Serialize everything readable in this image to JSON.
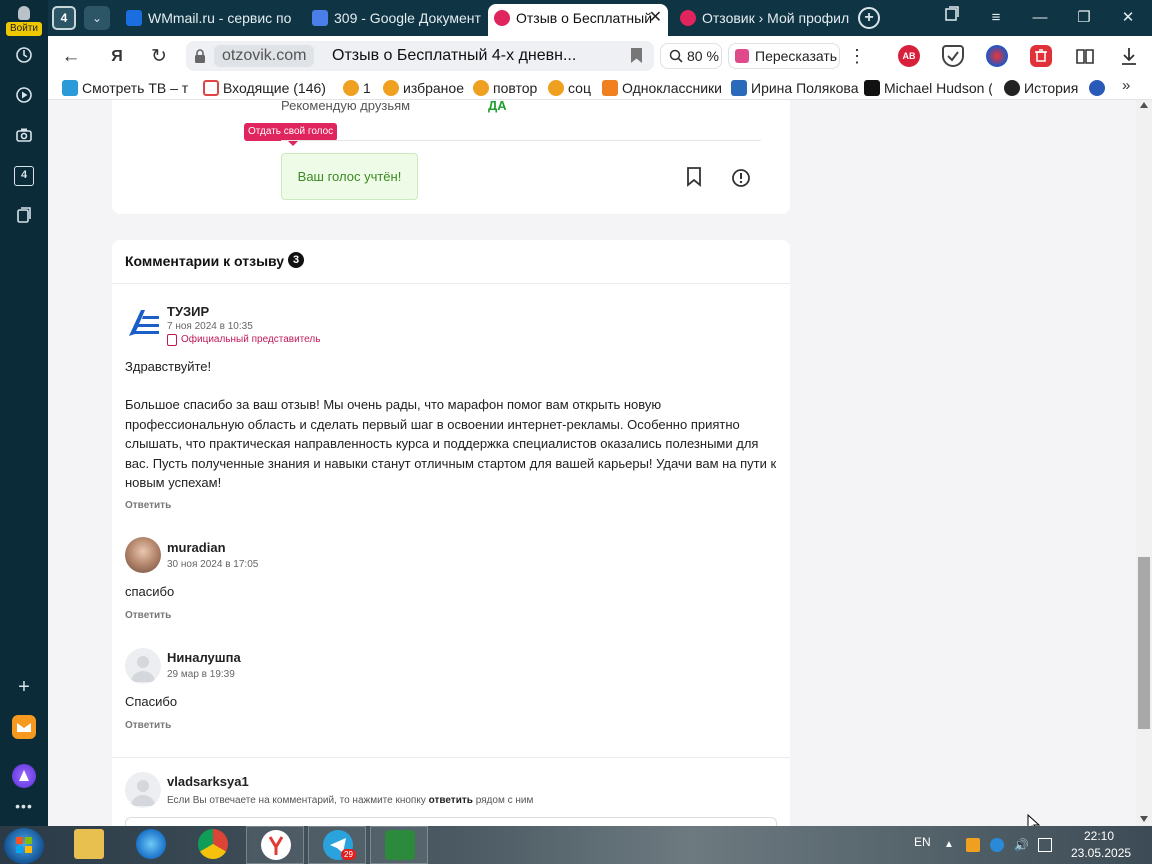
{
  "browser": {
    "sidebar": {
      "login_label": "Войти",
      "items": [
        "history-icon",
        "play-icon",
        "camera-icon",
        "collections-badge",
        "notes-icon"
      ],
      "collections_badge": "4"
    },
    "tab_counter": "4",
    "tabs": [
      {
        "label": "WMmail.ru - сервис по",
        "icon": "wmmail-icon",
        "color": "#1a6ee0",
        "active": false
      },
      {
        "label": "309 - Google Документ",
        "icon": "google-docs-icon",
        "color": "#4a7ee8",
        "active": false
      },
      {
        "label": "Отзыв о Бесплатный",
        "icon": "otzovik-icon",
        "color": "#e0245e",
        "active": true
      },
      {
        "label": "Отзовик › Мой профил",
        "icon": "otzovik-icon",
        "color": "#e0245e",
        "active": false
      }
    ],
    "address": {
      "domain": "otzovik.com",
      "page_title": "Отзыв о Бесплатный 4-х дневн...",
      "zoom": "80 %",
      "retell_label": "Пересказать"
    },
    "bookmarks": [
      {
        "label": "Смотреть ТВ – те",
        "icon": "tv-icon",
        "color": "#2a9ad8"
      },
      {
        "label": "Входящие (146) -",
        "icon": "gmail-icon",
        "color": "#d44"
      },
      {
        "label": "1",
        "icon": "folder-icon",
        "color": "#f0a020"
      },
      {
        "label": "избраное",
        "icon": "folder-icon",
        "color": "#f0a020"
      },
      {
        "label": "повтор",
        "icon": "folder-icon",
        "color": "#f0a020"
      },
      {
        "label": "соц",
        "icon": "folder-icon",
        "color": "#f0a020"
      },
      {
        "label": "Одноклассники",
        "icon": "ok-icon",
        "color": "#f08020"
      },
      {
        "label": "Ирина Полякова",
        "icon": "vk-icon",
        "color": "#2a6ab8"
      },
      {
        "label": "Michael Hudson (",
        "icon": "x-icon",
        "color": "#111"
      },
      {
        "label": "История",
        "icon": "history-icon",
        "color": "#222"
      }
    ]
  },
  "review": {
    "recommend_label": "Рекомендую друзьям",
    "recommend_value": "ДА",
    "vote_tooltip": "Отдать свой голос",
    "vote_done": "Ваш голос учтён!"
  },
  "comments": {
    "heading": "Комментарии к отзыву",
    "count": "3",
    "items": [
      {
        "author": "ТУЗИР",
        "date": "7 ноя 2024 в 10:35",
        "official": "Официальный представитель",
        "paragraphs": [
          "Здравствуйте!",
          "Большое спасибо за ваш отзыв! Мы очень рады, что марафон помог вам открыть новую профессиональную область и сделать первый шаг в освоении интернет-рекламы. Особенно приятно слышать, что практическая направленность курса и поддержка специалистов оказались полезными для вас. Пусть полученные знания и навыки станут отличным стартом для вашей карьеры! Удачи вам на пути к новым успехам!"
        ],
        "reply": "Ответить"
      },
      {
        "author": "muradian",
        "date": "30 ноя 2024 в 17:05",
        "paragraphs": [
          "спасибо"
        ],
        "reply": "Ответить"
      },
      {
        "author": "Ниналушпа",
        "date": "29 мар в 19:39",
        "paragraphs": [
          "Спасибо"
        ],
        "reply": "Ответить"
      }
    ],
    "new_comment": {
      "author": "vladsarksya1",
      "hint_before": "Если Вы отвечаете на комментарий, то нажмите кнопку",
      "hint_bold": "ответить",
      "hint_after": "рядом с ним"
    }
  },
  "taskbar": {
    "apps": [
      "explorer-icon",
      "ie-icon",
      "chrome-icon",
      "yandex-browser-icon",
      "telegram-icon",
      "app-icon"
    ],
    "telegram_badge": "29",
    "lang": "EN",
    "time": "22:10",
    "date": "23.05.2025"
  }
}
